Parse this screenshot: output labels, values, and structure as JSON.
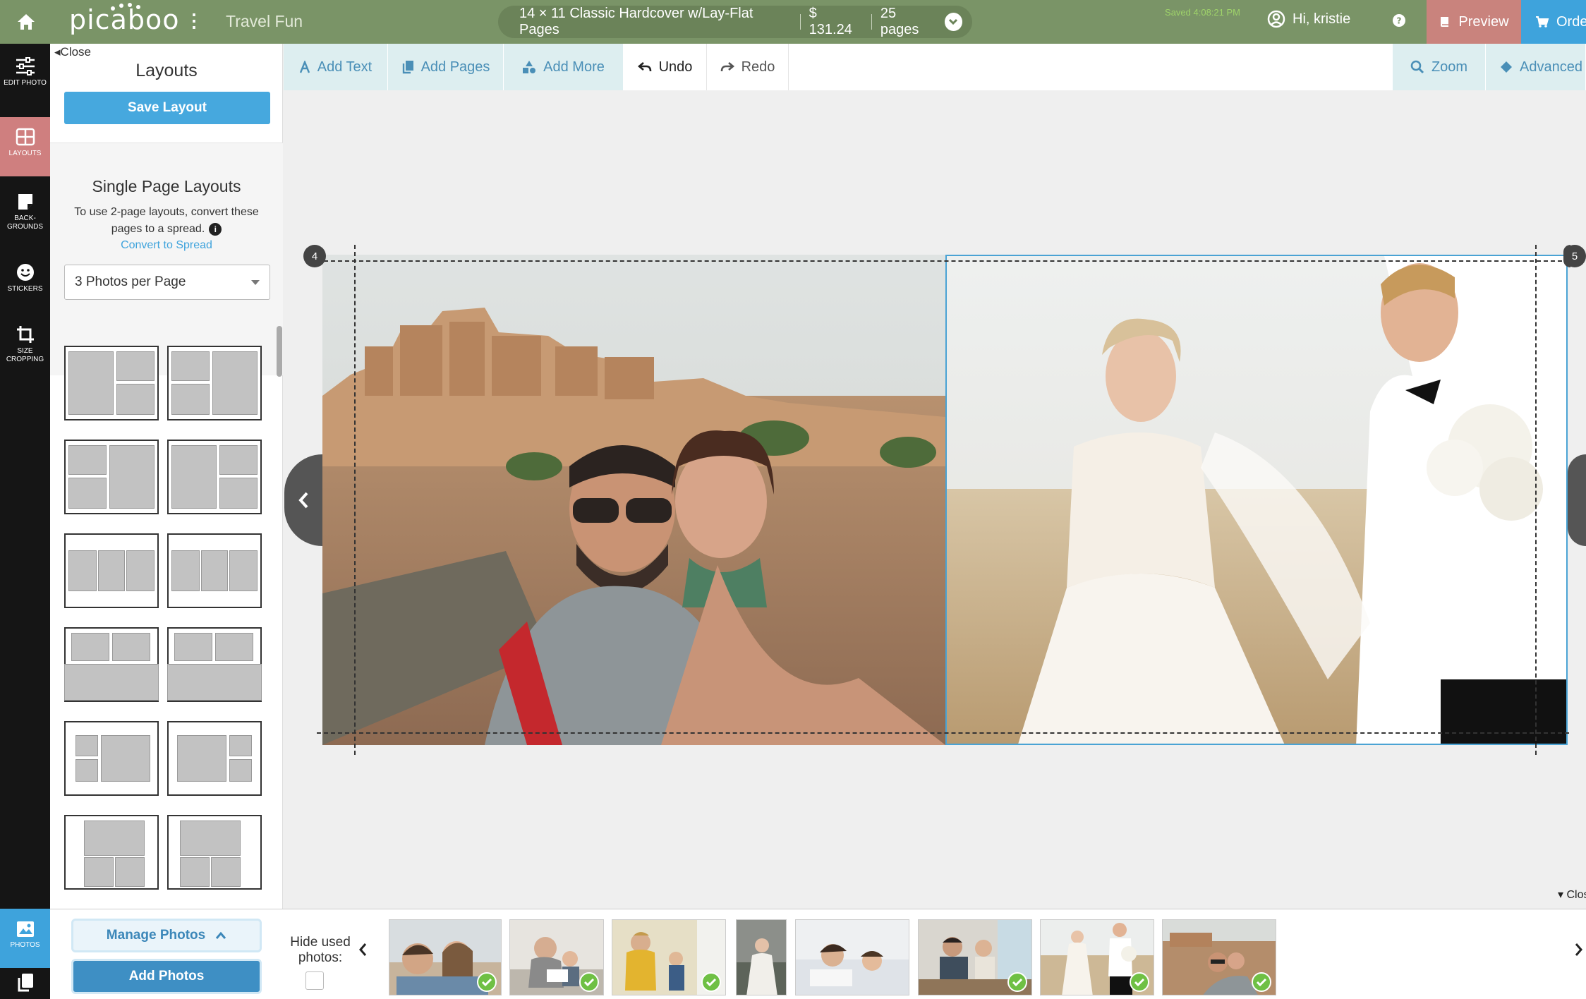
{
  "topbar": {
    "logo": "picaboo",
    "project_title": "Travel Fun",
    "product": "14 × 11 Classic Hardcover w/Lay-Flat Pages",
    "price": "$ 131.24",
    "pages": "25 pages",
    "saved": "Saved 4:08:21 PM",
    "user_greeting": "Hi, kristie",
    "preview_label": "Preview",
    "order_label": "Order",
    "colors": {
      "bar": "#7a9467",
      "preview": "#c9837d",
      "order": "#3ea3dc"
    }
  },
  "rail": {
    "items": [
      {
        "label": "EDIT PHOTO",
        "icon": "sliders-icon"
      },
      {
        "label": "LAYOUTS",
        "icon": "layout-grid-icon"
      },
      {
        "label": "BACK- GROUNDS",
        "icon": "background-icon"
      },
      {
        "label": "STICKERS",
        "icon": "smiley-icon"
      },
      {
        "label": "SIZE CROPPING",
        "icon": "crop-icon"
      },
      {
        "label": "PHOTOS",
        "icon": "image-icon"
      }
    ]
  },
  "layouts_panel": {
    "close_label": "Close",
    "title": "Layouts",
    "save_button": "Save Layout",
    "section_title": "Single Page Layouts",
    "hint": "To use 2-page layouts, convert these pages to a spread.",
    "convert_link": "Convert to Spread",
    "photos_per_page": "3 Photos per Page"
  },
  "toolbar": {
    "add_text": "Add Text",
    "add_pages": "Add Pages",
    "add_more": "Add More",
    "undo": "Undo",
    "redo": "Redo",
    "zoom": "Zoom",
    "advanced": "Advanced"
  },
  "canvas": {
    "left_page_number": "4",
    "right_page_number": "5",
    "close_label": "Close"
  },
  "tray": {
    "manage_photos": "Manage Photos",
    "add_photos": "Add Photos",
    "hide_used": "Hide used photos:",
    "photos": [
      {
        "name": "family-selfie",
        "used": true
      },
      {
        "name": "grandpa-reading",
        "used": true
      },
      {
        "name": "kid-yellow-room",
        "used": true
      },
      {
        "name": "bride-portrait",
        "used": false
      },
      {
        "name": "mother-child-bed",
        "used": false
      },
      {
        "name": "desk-study",
        "used": true
      },
      {
        "name": "wedding-field",
        "used": true
      },
      {
        "name": "travel-selfie",
        "used": true
      }
    ]
  }
}
